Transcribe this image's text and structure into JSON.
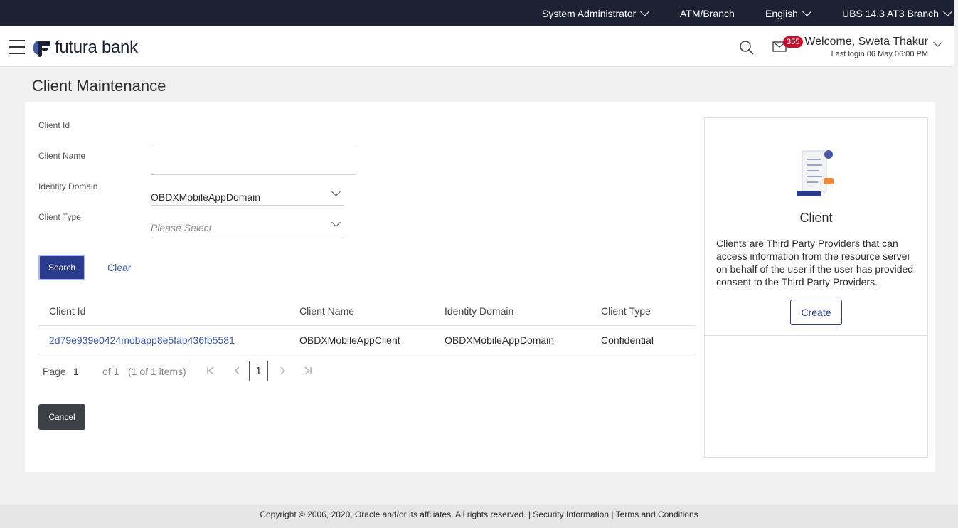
{
  "topbar": {
    "role": "System Administrator",
    "channel": "ATM/Branch",
    "language": "English",
    "branch": "UBS 14.3 AT3 Branch"
  },
  "header": {
    "logo_text": "futura bank",
    "mail_count": "355",
    "welcome": "Welcome, Sweta Thakur",
    "last_login": "Last login 06 May 06:00 PM"
  },
  "page": {
    "title": "Client Maintenance"
  },
  "form": {
    "client_id_label": "Client Id",
    "client_id_value": "",
    "client_name_label": "Client Name",
    "client_name_value": "",
    "identity_domain_label": "Identity Domain",
    "identity_domain_value": "OBDXMobileAppDomain",
    "client_type_label": "Client Type",
    "client_type_placeholder": "Please Select",
    "search_label": "Search",
    "clear_label": "Clear"
  },
  "table": {
    "headers": [
      "Client Id",
      "Client Name",
      "Identity Domain",
      "Client Type"
    ],
    "rows": [
      [
        "2d79e939e0424mobapp8e5fab436fb5581",
        "OBDXMobileAppClient",
        "OBDXMobileAppDomain",
        "Confidential"
      ]
    ]
  },
  "pager": {
    "page_label": "Page",
    "page_value": "1",
    "of_label": "of 1",
    "items_label": "(1 of 1 items)",
    "current": "1"
  },
  "actions": {
    "cancel_label": "Cancel"
  },
  "card": {
    "title": "Client",
    "description": "Clients are Third Party Providers that can access information from the resource server on behalf of the user if the user has provided consent to the Third Party Providers.",
    "create_label": "Create"
  },
  "footer": {
    "copyright": "Copyright © 2006, 2020, Oracle and/or its affiliates. All rights reserved.",
    "security": "Security Information",
    "terms": "Terms and Conditions"
  },
  "colors": {
    "topbar": "#1c2233",
    "primary": "#2a3a8c",
    "link": "#3d5bb3",
    "badge": "#c8102e"
  }
}
